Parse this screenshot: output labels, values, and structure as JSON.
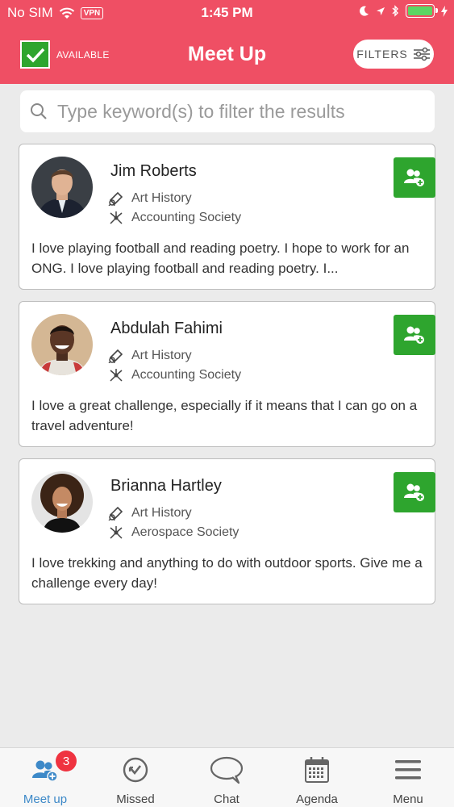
{
  "status_bar": {
    "carrier": "No SIM",
    "vpn": "VPN",
    "time": "1:45 PM"
  },
  "header": {
    "available_label": "AVAILABLE",
    "title": "Meet Up",
    "filters_label": "FILTERS"
  },
  "search": {
    "placeholder": "Type keyword(s) to filter the results"
  },
  "people": [
    {
      "name": "Jim Roberts",
      "course": "Art History",
      "society": "Accounting Society",
      "bio": "I love playing football and reading poetry. I hope to work for an ONG. I love playing football and reading poetry. I..."
    },
    {
      "name": "Abdulah Fahimi",
      "course": "Art History",
      "society": "Accounting Society",
      "bio": "I love a great challenge, especially if it means that I can go on a travel adventure!"
    },
    {
      "name": "Brianna Hartley",
      "course": "Art History",
      "society": "Aerospace Society",
      "bio": "I love trekking and anything to do with outdoor sports. Give me a challenge every day!"
    }
  ],
  "tabs": [
    {
      "label": "Meet up",
      "icon": "people-icon",
      "badge": "3"
    },
    {
      "label": "Missed",
      "icon": "missed-icon"
    },
    {
      "label": "Chat",
      "icon": "chat-icon"
    },
    {
      "label": "Agenda",
      "icon": "calendar-icon"
    },
    {
      "label": "Menu",
      "icon": "menu-icon"
    }
  ],
  "colors": {
    "brand": "#ef4f64",
    "accent_green": "#2ea52e",
    "active_tab": "#3d89c8"
  }
}
